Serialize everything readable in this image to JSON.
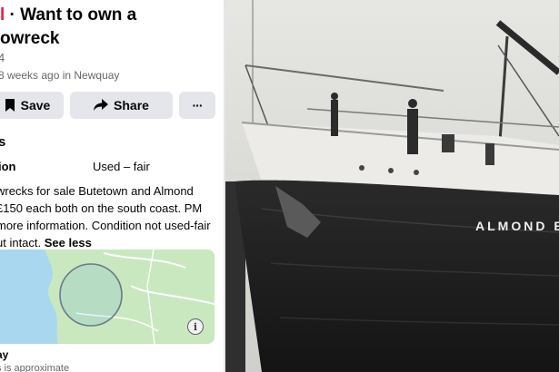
{
  "listing": {
    "title_prefix": "l",
    "title_line1": " · Want to own a",
    "title_line2": "owreck",
    "price": "4",
    "listed": "8 weeks ago in Newquay"
  },
  "actions": {
    "save_label": "Save",
    "share_label": "Share",
    "more_label": "···"
  },
  "details": {
    "heading": "s",
    "condition_label": "ion",
    "condition_value": "Used – fair",
    "description_lines": [
      "wrecks for sale Butetown and Almond",
      " £150 each both on the south coast. PM",
      " more information. Condition not used-fair",
      "ut intact."
    ],
    "see_less": "See less"
  },
  "location": {
    "name": "ay",
    "note": "s is approximate",
    "info_icon": "info-icon"
  },
  "photo": {
    "ship_name": "ALMOND B"
  },
  "colors": {
    "accent_red": "#e41e3f",
    "button_bg": "#e4e6eb",
    "map_water": "#a9d7ef",
    "map_land": "#c9e8bf"
  }
}
